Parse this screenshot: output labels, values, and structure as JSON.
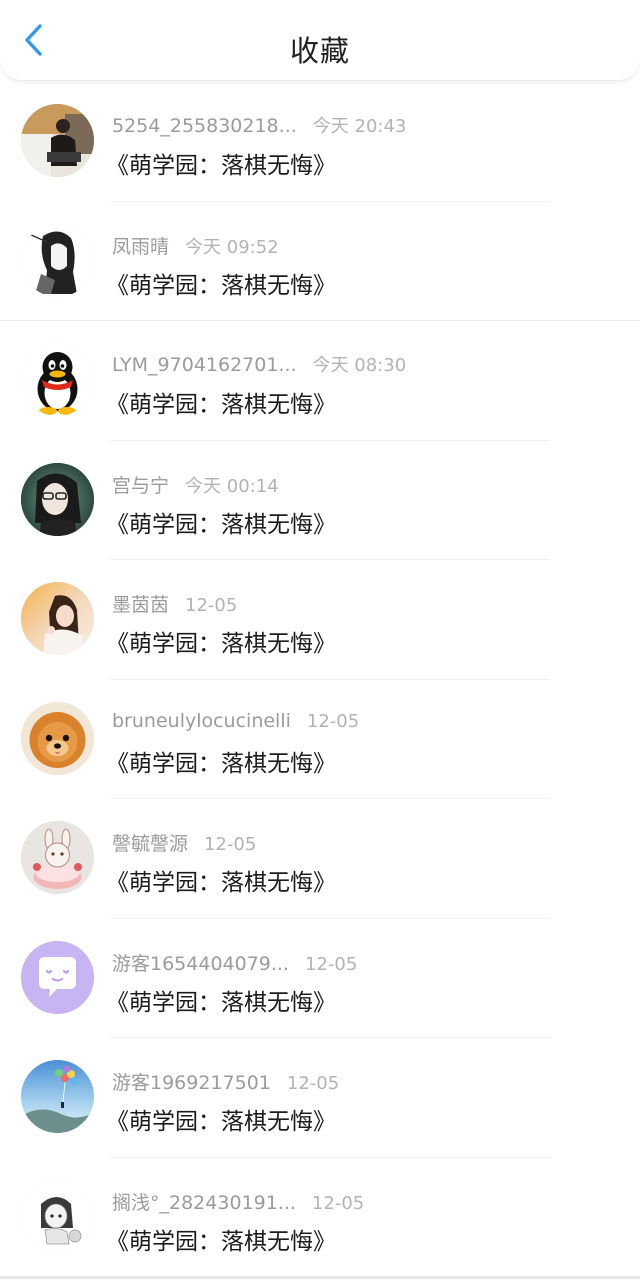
{
  "header": {
    "title": "收藏"
  },
  "colors": {
    "accent": "#2f9be8",
    "username": "#9b9b9b",
    "time": "#b3b3b3"
  },
  "items": [
    {
      "username": "5254_255830218...",
      "time": "今天 20:43",
      "work": "《萌学园：落棋无悔》",
      "avatar": "photo-person-car"
    },
    {
      "username": "凤雨晴",
      "time": "今天 09:52",
      "work": "《萌学园：落棋无悔》",
      "avatar": "ink-sketch-girl"
    },
    {
      "username": "LYM_9704162701...",
      "time": "今天 08:30",
      "work": "《萌学园：落棋无悔》",
      "avatar": "qq-penguin"
    },
    {
      "username": "宫与宁",
      "time": "今天 00:14",
      "work": "《萌学园：落棋无悔》",
      "avatar": "anime-boy-glasses"
    },
    {
      "username": "墨茵茵",
      "time": "12-05",
      "work": "《萌学园：落棋无悔》",
      "avatar": "photo-girl-warm"
    },
    {
      "username": "bruneulylocucinelli",
      "time": "12-05",
      "work": "《萌学园：落棋无悔》",
      "avatar": "pomeranian-dog"
    },
    {
      "username": "謦毓謦源",
      "time": "12-05",
      "work": "《萌学园：落棋无悔》",
      "avatar": "cute-bunny-cake"
    },
    {
      "username": "游客1654404079...",
      "time": "12-05",
      "work": "《萌学园：落棋无悔》",
      "avatar": "purple-chat-bubble"
    },
    {
      "username": "游客1969217501",
      "time": "12-05",
      "work": "《萌学园：落棋无悔》",
      "avatar": "balloons-sky"
    },
    {
      "username": "搁浅°_282430191...",
      "time": "12-05",
      "work": "《萌学园：落棋无悔》",
      "avatar": "sketch-chibi-girl"
    }
  ]
}
